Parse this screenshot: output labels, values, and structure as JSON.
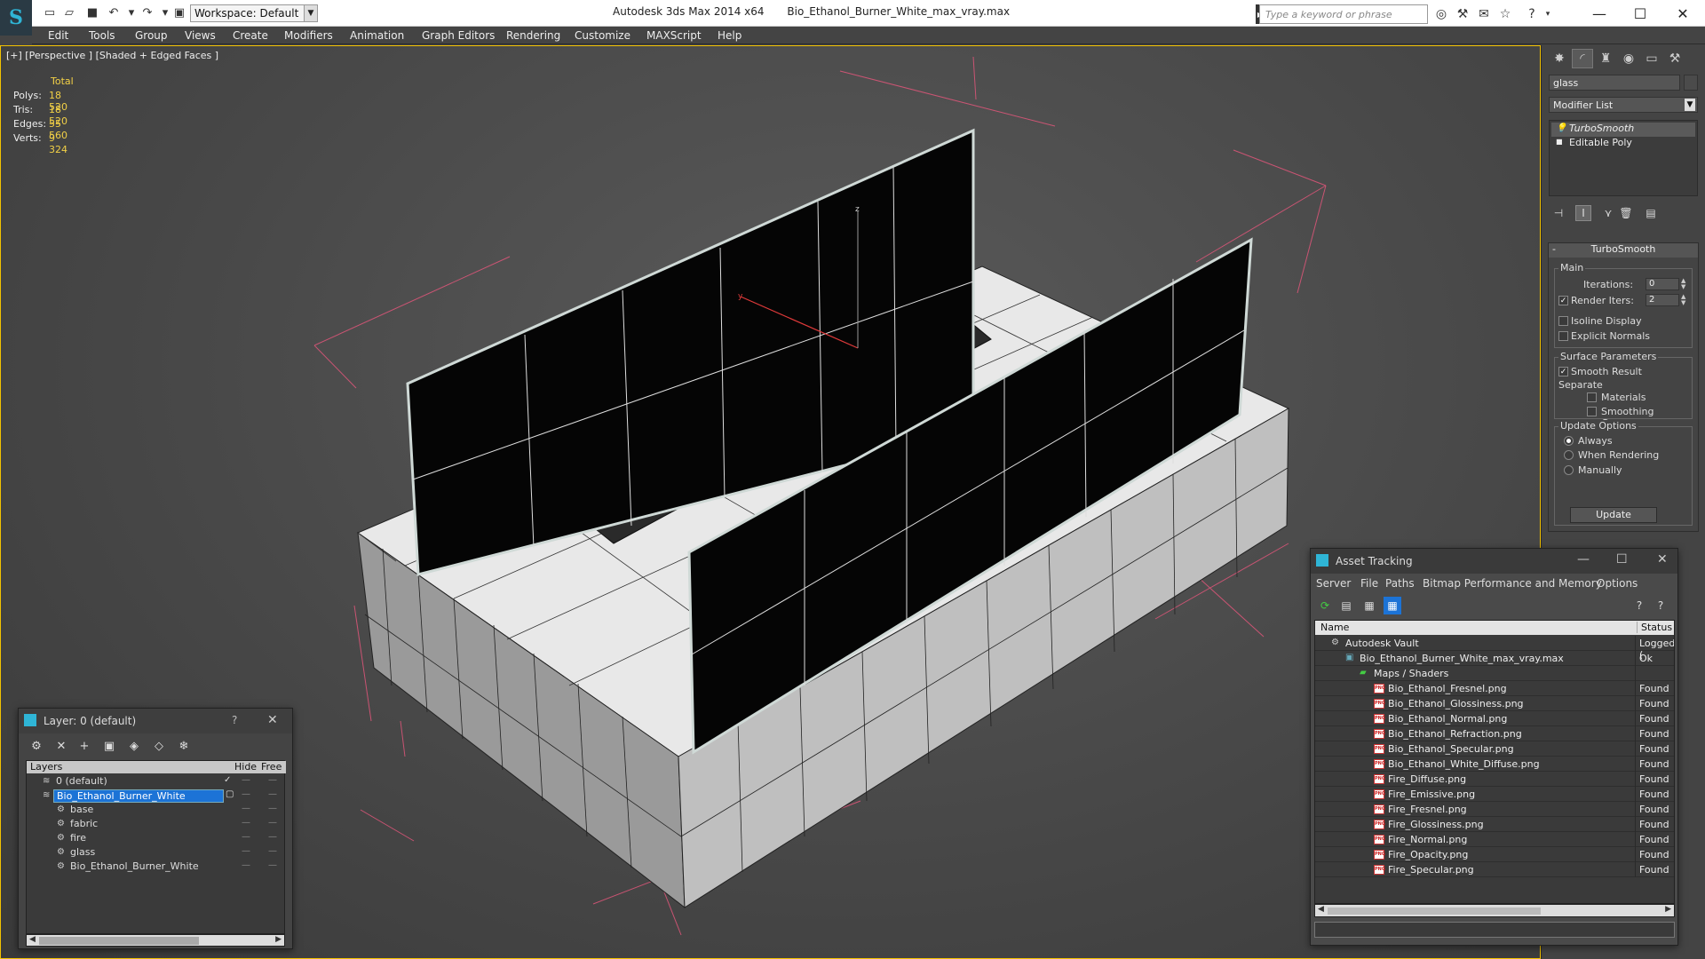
{
  "titlebar": {
    "workspace": "Workspace: Default",
    "app_name": "Autodesk 3ds Max  2014 x64",
    "file_name": "Bio_Ethanol_Burner_White_max_vray.max",
    "search_placeholder": "Type a keyword or phrase"
  },
  "menu": [
    "Edit",
    "Tools",
    "Group",
    "Views",
    "Create",
    "Modifiers",
    "Animation",
    "Graph Editors",
    "Rendering",
    "Customize",
    "MAXScript",
    "Help"
  ],
  "viewport": {
    "label": "[+] [Perspective ] [Shaded + Edged Faces ]",
    "stats_header": "Total",
    "stats": [
      {
        "label": "Polys:",
        "value": "18 520"
      },
      {
        "label": "Tris:",
        "value": "18 520"
      },
      {
        "label": "Edges:",
        "value": "55 560"
      },
      {
        "label": "Verts:",
        "value": "9 324"
      }
    ]
  },
  "command_panel": {
    "object_name": "glass",
    "modifier_list": "Modifier List",
    "stack": [
      "TurboSmooth",
      "Editable Poly"
    ],
    "turbosmooth": {
      "title": "TurboSmooth",
      "main": "Main",
      "iterations_label": "Iterations:",
      "iterations_value": "0",
      "render_iters_label": "Render Iters:",
      "render_iters_value": "2",
      "isoline": "Isoline Display",
      "explicit_normals": "Explicit Normals",
      "surface_params": "Surface Parameters",
      "smooth_result": "Smooth Result",
      "separate": "Separate",
      "materials": "Materials",
      "smoothing_groups": "Smoothing Groups",
      "update_options": "Update Options",
      "always": "Always",
      "when_rendering": "When Rendering",
      "manually": "Manually",
      "update_button": "Update"
    }
  },
  "layer_window": {
    "title": "Layer: 0 (default)",
    "help": "?",
    "columns": [
      "Layers",
      "Hide",
      "Free"
    ],
    "rows": [
      {
        "name": "0 (default)",
        "indent": 0
      },
      {
        "name": "Bio_Ethanol_Burner_White",
        "indent": 0
      },
      {
        "name": "base",
        "indent": 1
      },
      {
        "name": "fabric",
        "indent": 1
      },
      {
        "name": "fire",
        "indent": 1
      },
      {
        "name": "glass",
        "indent": 1
      },
      {
        "name": "Bio_Ethanol_Burner_White",
        "indent": 1
      }
    ]
  },
  "asset_window": {
    "title": "Asset Tracking",
    "menu": [
      "Server",
      "File",
      "Paths",
      "Bitmap Performance and Memory",
      "Options"
    ],
    "columns": [
      "Name",
      "Status"
    ],
    "rows": [
      {
        "name": "Autodesk Vault",
        "status": "Logged (",
        "indent": 0,
        "icon": "vault"
      },
      {
        "name": "Bio_Ethanol_Burner_White_max_vray.max",
        "status": "Ok",
        "indent": 1,
        "icon": "max"
      },
      {
        "name": "Maps / Shaders",
        "status": "",
        "indent": 2,
        "icon": "folder"
      },
      {
        "name": "Bio_Ethanol_Fresnel.png",
        "status": "Found",
        "indent": 3,
        "icon": "png"
      },
      {
        "name": "Bio_Ethanol_Glossiness.png",
        "status": "Found",
        "indent": 3,
        "icon": "png"
      },
      {
        "name": "Bio_Ethanol_Normal.png",
        "status": "Found",
        "indent": 3,
        "icon": "png"
      },
      {
        "name": "Bio_Ethanol_Refraction.png",
        "status": "Found",
        "indent": 3,
        "icon": "png"
      },
      {
        "name": "Bio_Ethanol_Specular.png",
        "status": "Found",
        "indent": 3,
        "icon": "png"
      },
      {
        "name": "Bio_Ethanol_White_Diffuse.png",
        "status": "Found",
        "indent": 3,
        "icon": "png"
      },
      {
        "name": "Fire_Diffuse.png",
        "status": "Found",
        "indent": 3,
        "icon": "png"
      },
      {
        "name": "Fire_Emissive.png",
        "status": "Found",
        "indent": 3,
        "icon": "png"
      },
      {
        "name": "Fire_Fresnel.png",
        "status": "Found",
        "indent": 3,
        "icon": "png"
      },
      {
        "name": "Fire_Glossiness.png",
        "status": "Found",
        "indent": 3,
        "icon": "png"
      },
      {
        "name": "Fire_Normal.png",
        "status": "Found",
        "indent": 3,
        "icon": "png"
      },
      {
        "name": "Fire_Opacity.png",
        "status": "Found",
        "indent": 3,
        "icon": "png"
      },
      {
        "name": "Fire_Specular.png",
        "status": "Found",
        "indent": 3,
        "icon": "png"
      }
    ]
  },
  "colors": {
    "viewport_border": "#f2c200",
    "stat_value": "#f2d046",
    "selection": "#1c73d6",
    "accent": "#2fb5d6"
  }
}
